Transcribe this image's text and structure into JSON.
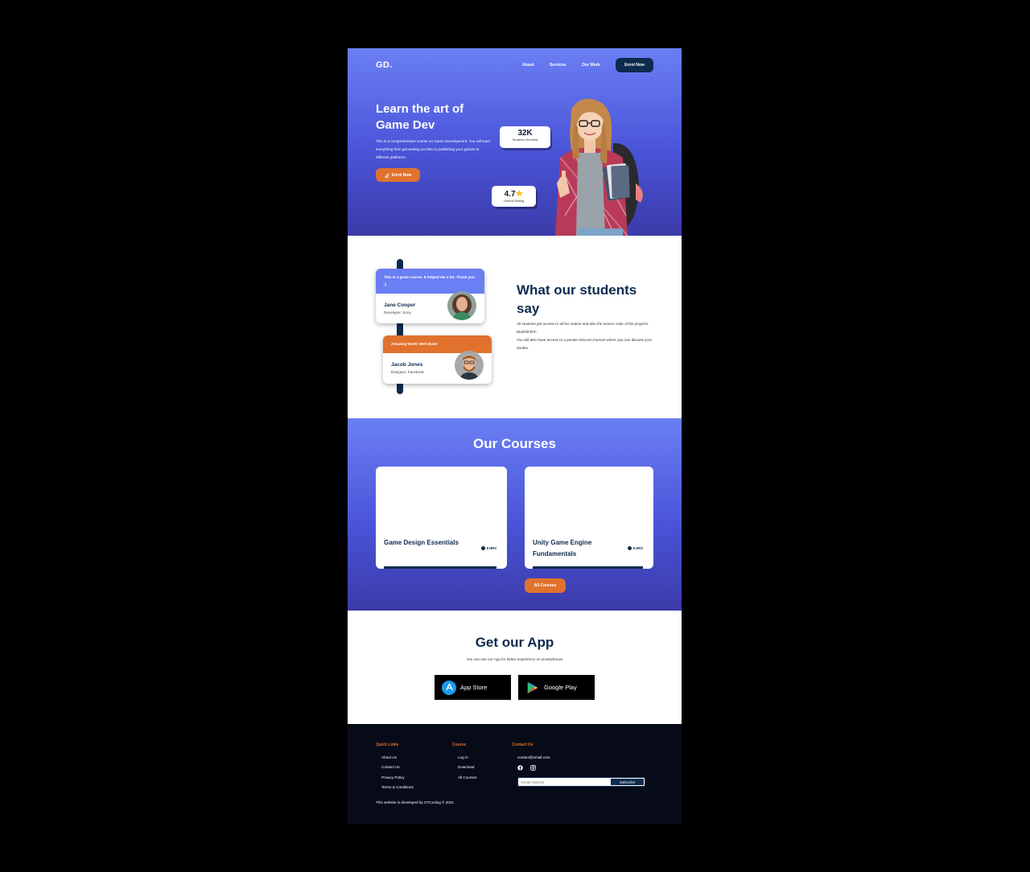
{
  "brand": {
    "logo": "GD."
  },
  "nav": {
    "about": "About",
    "services": "Services",
    "our_work": "Our Work",
    "enrol": "Enrol Now"
  },
  "hero": {
    "title": "Learn the art of Game Dev",
    "text": "This is a comprehensive course on Game Development. You will learn everything from generating an idea to publishing your games to different platforms.",
    "enrol_label": "Enrol Now",
    "stat_students_value": "32K",
    "stat_students_label": "Students Enrolled",
    "stat_rating_value": "4.7",
    "stat_rating_label": "Overall Rating"
  },
  "testimonials": {
    "title": "What our students say",
    "text_line1": "All students get access to all the videos and also the source code of the projects. Blahhhhhhh",
    "text_line2": "You will also have access to a private Discord channel where you can discuss your doubts.",
    "items": [
      {
        "quote": "This is a great course. It helped me a lot. Thank you :)",
        "name": "Jane Cooper",
        "role": "Developer, Sony"
      },
      {
        "quote": "Amazing Work! Well done!",
        "name": "Jacob Jones",
        "role": "Designer, Facebook"
      }
    ]
  },
  "courses": {
    "title": "Our Courses",
    "items": [
      {
        "title": "Game Design Essentials",
        "hours": "8 HRS"
      },
      {
        "title": "Unity Game Engine Fundamentals",
        "hours": "8 HRS"
      }
    ],
    "all_label": "All Courses"
  },
  "app": {
    "title": "Get our App",
    "text": "You can use our App for better experience on smartphones",
    "app_store": "App Store",
    "google_play": "Google Play"
  },
  "footer": {
    "quick_links_title": "Quick Links",
    "quick_links": [
      "About Us",
      "Contact Us",
      "Privacy Policy",
      "Terms & Conditions"
    ],
    "course_title": "Course",
    "course_links": [
      "Log In",
      "Download",
      "All Courses"
    ],
    "contact_title": "Contact Us",
    "email": "contact@email.com",
    "email_placeholder": "Email Address",
    "subscribe": "Subscribe",
    "credit": "This website is developed by GTCoding © 2021"
  },
  "colors": {
    "primary": "#6b7ff4",
    "accent": "#e0722e",
    "navy": "#0d2b4e",
    "footer": "#070b18"
  },
  "icons": [
    "edit-icon",
    "star-icon",
    "clock-icon",
    "appstore-icon",
    "google-play-icon",
    "facebook-icon",
    "instagram-icon"
  ]
}
